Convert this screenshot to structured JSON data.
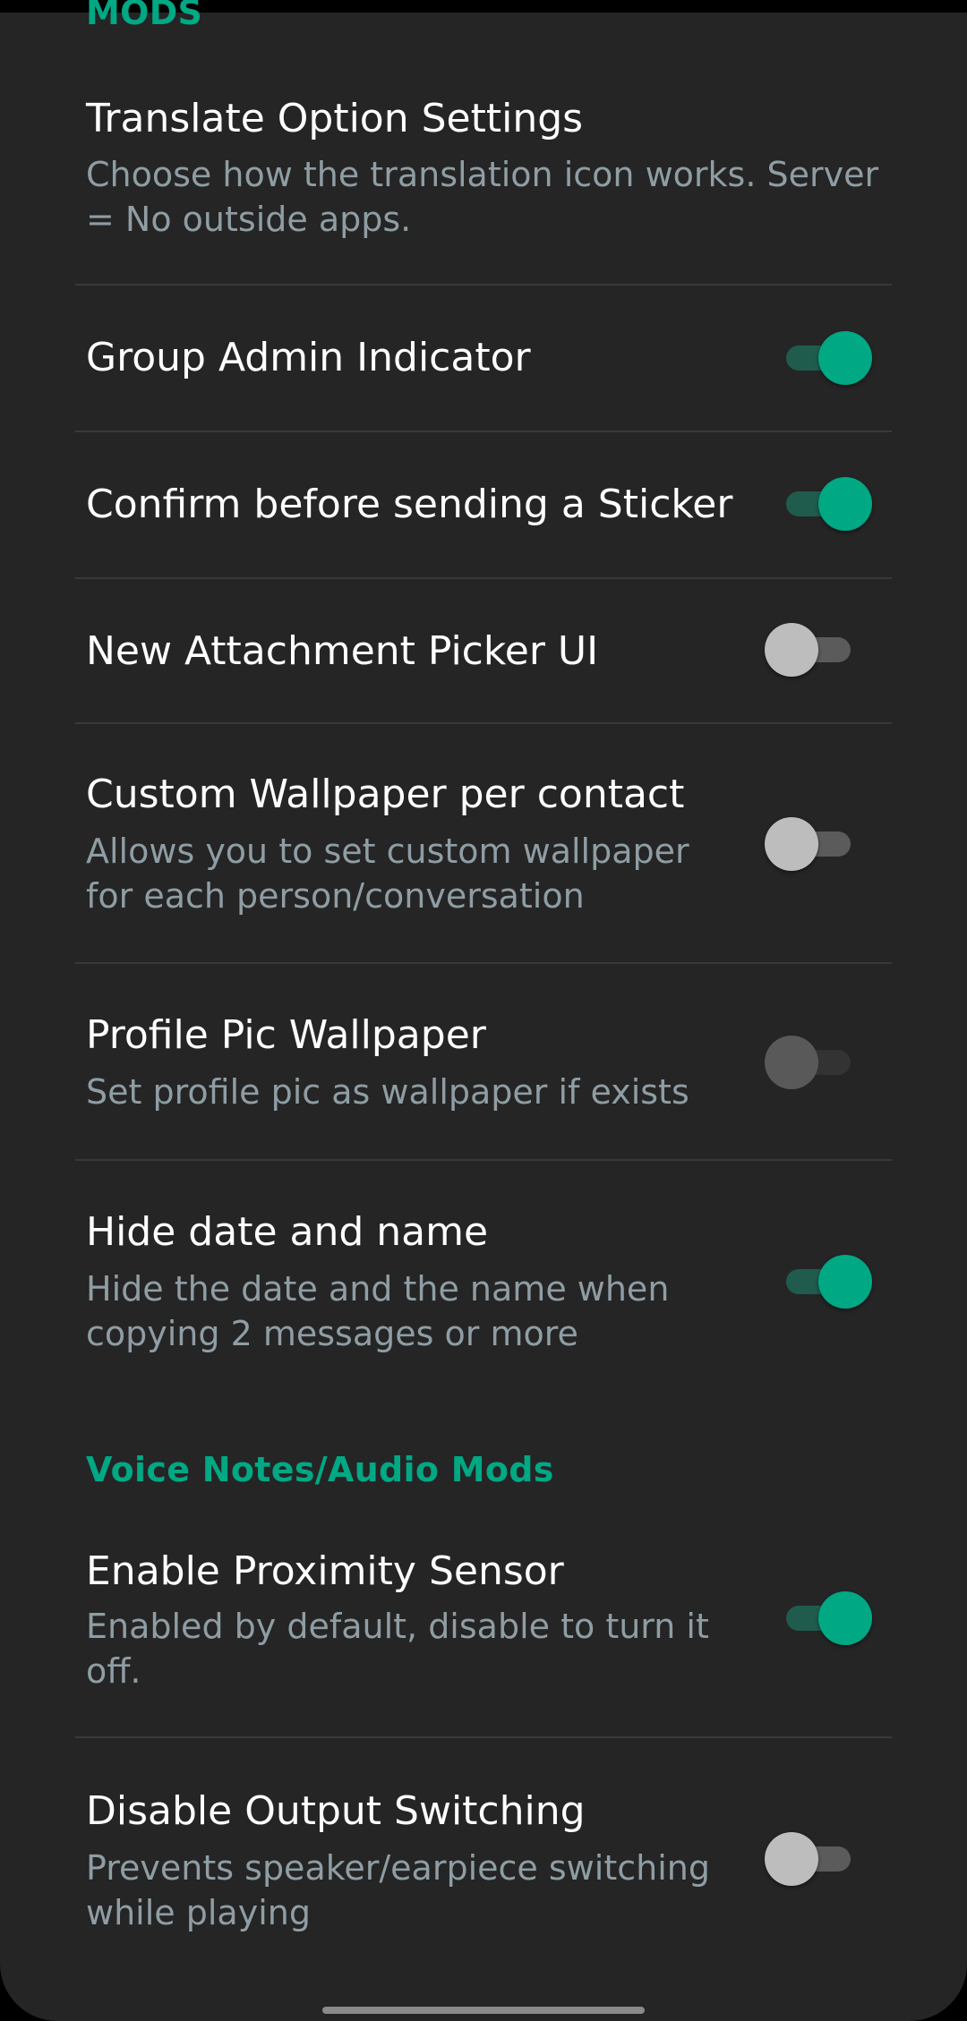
{
  "sections": {
    "top_header_partial": "MODS",
    "voice_header": "Voice Notes/Audio Mods"
  },
  "settings": [
    {
      "title": "Translate Option Settings",
      "description": "Choose how the translation icon works. Server = No outside apps."
    },
    {
      "title": "Group Admin Indicator",
      "toggle": "on"
    },
    {
      "title": "Confirm before sending a Sticker",
      "toggle": "on"
    },
    {
      "title": "New Attachment Picker UI",
      "toggle": "off"
    },
    {
      "title": "Custom Wallpaper per contact",
      "description": "Allows you to set custom wallpaper for each person/conversation",
      "toggle": "off"
    },
    {
      "title": "Profile Pic Wallpaper",
      "description": "Set profile pic as wallpaper if exists",
      "toggle": "disabled"
    },
    {
      "title": "Hide date and name",
      "description": "Hide the date and the name when copying 2 messages or more",
      "toggle": "on"
    },
    {
      "title": "Enable Proximity Sensor",
      "description": "Enabled by default, disable to turn it off.",
      "toggle": "on"
    },
    {
      "title": "Disable Output Switching",
      "description": "Prevents speaker/earpiece switching while playing",
      "toggle": "off"
    }
  ],
  "colors": {
    "accent": "#00a884",
    "background": "#252525",
    "title_text": "#ffffff",
    "secondary_text": "#8f9da4",
    "divider": "#393939"
  }
}
